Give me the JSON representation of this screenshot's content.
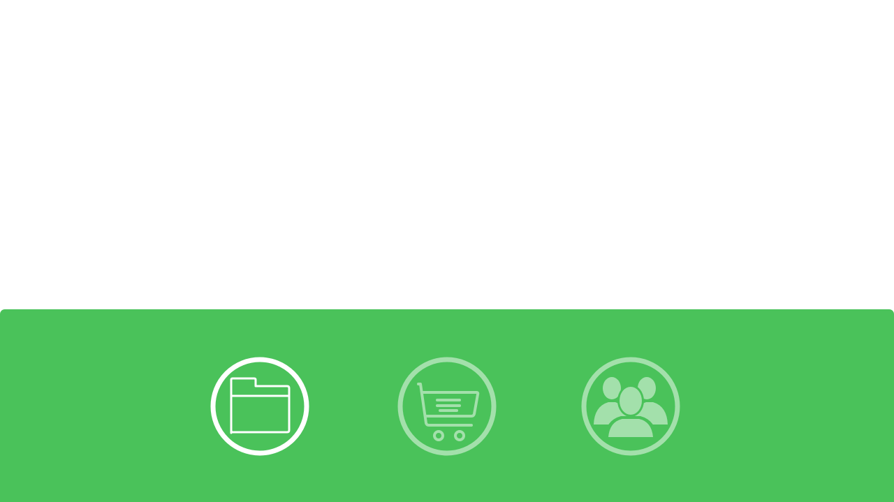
{
  "colors": {
    "panel_background": "#4ac25a",
    "active_icon": "#ffffff",
    "inactive_icon": "#a3e0ab",
    "page_background": "#ffffff"
  },
  "bottom_nav": {
    "items": [
      {
        "icon": "folder-icon",
        "active": true
      },
      {
        "icon": "shopping-cart-icon",
        "active": false
      },
      {
        "icon": "users-group-icon",
        "active": false
      }
    ]
  }
}
